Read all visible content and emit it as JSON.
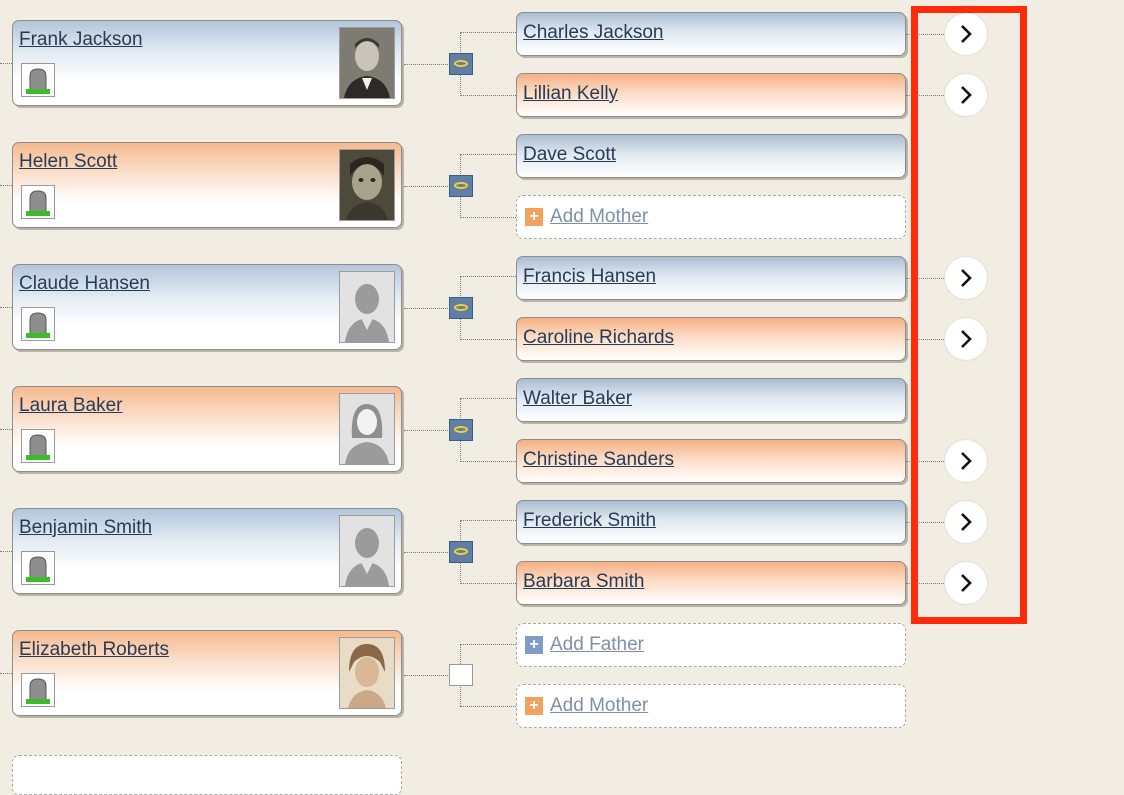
{
  "people": [
    {
      "name": "Frank Jackson",
      "gender": "male",
      "photo": "photo"
    },
    {
      "name": "Helen Scott",
      "gender": "female",
      "photo": "photo"
    },
    {
      "name": "Claude Hansen",
      "gender": "male",
      "photo": "silhouette-male"
    },
    {
      "name": "Laura Baker",
      "gender": "female",
      "photo": "silhouette-female"
    },
    {
      "name": "Benjamin Smith",
      "gender": "male",
      "photo": "silhouette-male"
    },
    {
      "name": "Elizabeth Roberts",
      "gender": "female",
      "photo": "photo"
    }
  ],
  "parents": [
    {
      "father": "Charles Jackson",
      "mother": "Lillian Kelly"
    },
    {
      "father": "Dave Scott",
      "mother_add": "Add Mother"
    },
    {
      "father": "Francis Hansen",
      "mother": "Caroline Richards"
    },
    {
      "father": "Walter Baker",
      "mother": "Christine Sanders"
    },
    {
      "father": "Frederick Smith",
      "mother": "Barbara Smith"
    },
    {
      "father_add": "Add Father",
      "mother_add": "Add Mother"
    }
  ],
  "colors": {
    "highlight": "#ff2a0a",
    "marriage_box": "#5e7fa6",
    "ring": "#f4cd2e",
    "background": "#f1ede3"
  }
}
